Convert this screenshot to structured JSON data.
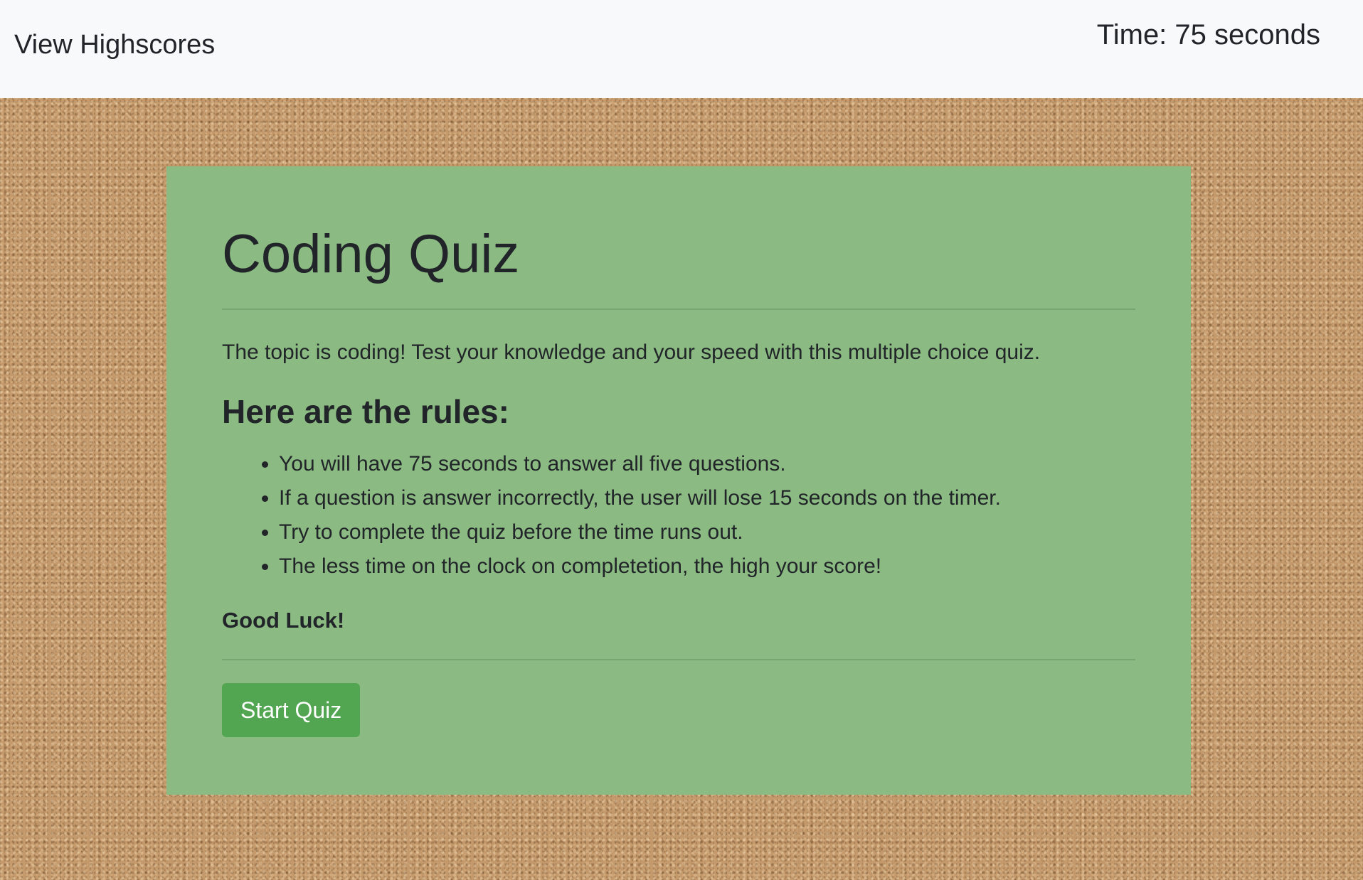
{
  "navbar": {
    "highscores_label": "View Highscores",
    "timer_text": "Time: 75 seconds"
  },
  "card": {
    "title": "Coding Quiz",
    "intro": "The topic is coding! Test your knowledge and your speed with this multiple choice quiz.",
    "rules_heading": "Here are the rules:",
    "rules": [
      "You will have 75 seconds to answer all five questions.",
      "If a question is answer incorrectly, the user will lose 15 seconds on the timer.",
      "Try to complete the quiz before the time runs out.",
      "The less time on the clock on completetion, the high your score!"
    ],
    "closing": "Good Luck!",
    "start_button_label": "Start Quiz"
  },
  "colors": {
    "navbar_bg": "#f8f9fa",
    "card_bg": "#8bbb82",
    "button_bg": "#52a651",
    "background": "cork texture"
  }
}
